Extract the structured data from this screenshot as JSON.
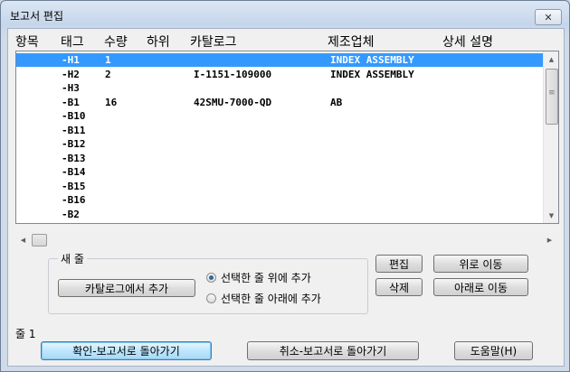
{
  "window": {
    "title": "보고서 편집",
    "close_glyph": "✕"
  },
  "columns": [
    "항목",
    "태그",
    "수량",
    "하위",
    "카탈로그",
    "제조업체",
    "상세 설명"
  ],
  "rows": [
    {
      "tag": "-H1",
      "qty": "1",
      "sub": "",
      "catalog": "",
      "mfr": "INDEX ASSEMBLY",
      "selected": true
    },
    {
      "tag": "-H2",
      "qty": "2",
      "sub": "",
      "catalog": "I-1151-109000",
      "mfr": "INDEX ASSEMBLY",
      "selected": false
    },
    {
      "tag": "-H3",
      "qty": "",
      "sub": "",
      "catalog": "",
      "mfr": "",
      "selected": false
    },
    {
      "tag": "-B1",
      "qty": "16",
      "sub": "",
      "catalog": "42SMU-7000-QD",
      "mfr": "AB",
      "selected": false
    },
    {
      "tag": "-B10",
      "qty": "",
      "sub": "",
      "catalog": "",
      "mfr": "",
      "selected": false
    },
    {
      "tag": "-B11",
      "qty": "",
      "sub": "",
      "catalog": "",
      "mfr": "",
      "selected": false
    },
    {
      "tag": "-B12",
      "qty": "",
      "sub": "",
      "catalog": "",
      "mfr": "",
      "selected": false
    },
    {
      "tag": "-B13",
      "qty": "",
      "sub": "",
      "catalog": "",
      "mfr": "",
      "selected": false
    },
    {
      "tag": "-B14",
      "qty": "",
      "sub": "",
      "catalog": "",
      "mfr": "",
      "selected": false
    },
    {
      "tag": "-B15",
      "qty": "",
      "sub": "",
      "catalog": "",
      "mfr": "",
      "selected": false
    },
    {
      "tag": "-B16",
      "qty": "",
      "sub": "",
      "catalog": "",
      "mfr": "",
      "selected": false
    },
    {
      "tag": "-B2",
      "qty": "",
      "sub": "",
      "catalog": "",
      "mfr": "",
      "selected": false
    }
  ],
  "new_row_group": {
    "label": "새 줄",
    "add_from_catalog": "카탈로그에서 추가",
    "radio_above": "선택한 줄 위에 추가",
    "radio_below": "선택한 줄 아래에 추가",
    "selected_option": "above"
  },
  "buttons": {
    "edit": "편집",
    "delete": "삭제",
    "move_up": "위로 이동",
    "move_down": "아래로 이동",
    "ok": "확인-보고서로 돌아가기",
    "cancel": "취소-보고서로 돌아가기",
    "help": "도움말(H)"
  },
  "status": "줄 1",
  "icons": {
    "scroll_up": "▲",
    "scroll_down": "▼",
    "scroll_left": "◀",
    "scroll_right": "▶",
    "grip": "≡"
  },
  "colors": {
    "selection": "#3399ff",
    "list_bg": "#ffffff",
    "dialog_bg": "#f0f0f0"
  }
}
